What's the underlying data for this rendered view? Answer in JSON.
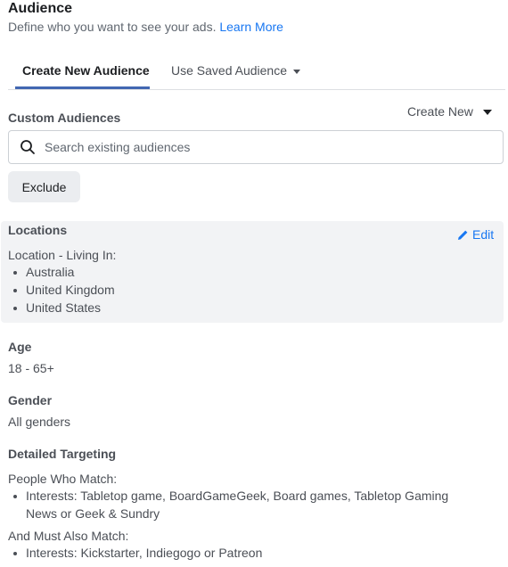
{
  "header": {
    "title": "Audience",
    "subtitle": "Define who you want to see your ads.",
    "learn_more": "Learn More"
  },
  "tabs": [
    {
      "label": "Create New Audience",
      "active": true
    },
    {
      "label": "Use Saved Audience",
      "active": false
    }
  ],
  "custom_audiences": {
    "label": "Custom Audiences",
    "create_new": "Create New",
    "search_placeholder": "Search existing audiences",
    "exclude_label": "Exclude"
  },
  "locations": {
    "label": "Locations",
    "edit_label": "Edit",
    "living_in_label": "Location - Living In:",
    "items": [
      "Australia",
      "United Kingdom",
      "United States"
    ]
  },
  "age": {
    "label": "Age",
    "value": "18 - 65+"
  },
  "gender": {
    "label": "Gender",
    "value": "All genders"
  },
  "detailed_targeting": {
    "label": "Detailed Targeting",
    "match_label": "People Who Match:",
    "match_items": [
      "Interests: Tabletop game, BoardGameGeek, Board games, Tabletop Gaming News or Geek & Sundry"
    ],
    "also_match_label": "And Must Also Match:",
    "also_match_items": [
      "Interests: Kickstarter, Indiegogo or Patreon"
    ]
  },
  "colors": {
    "link": "#1877f2",
    "tab_underline": "#4267b2",
    "panel_bg": "#f2f3f5"
  }
}
